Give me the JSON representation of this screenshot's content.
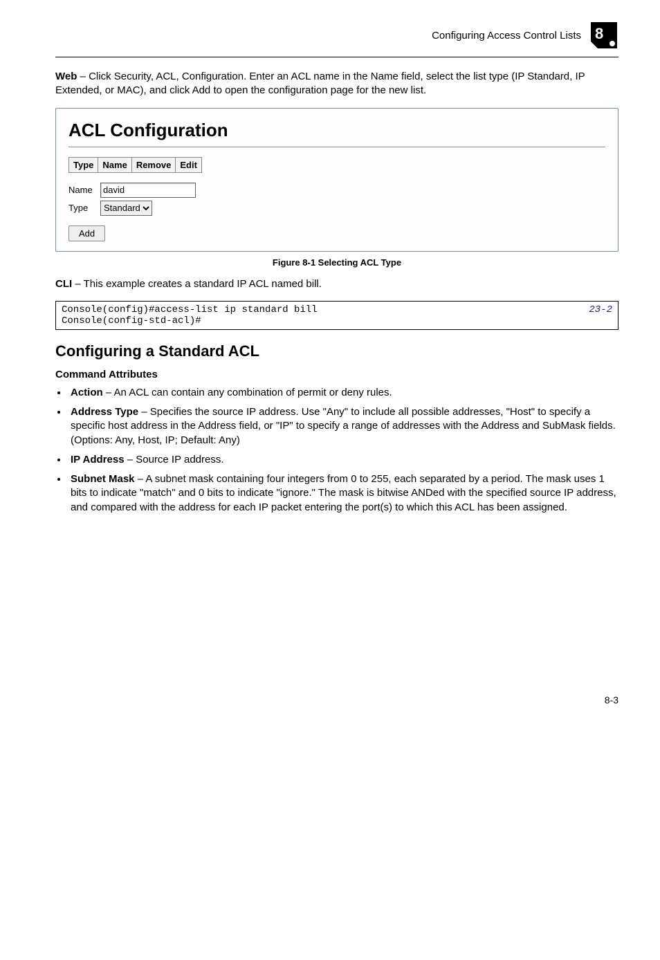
{
  "header": {
    "title": "Configuring Access Control Lists",
    "chapter": "8"
  },
  "intro": {
    "term": "Web",
    "text": " – Click Security, ACL, Configuration. Enter an ACL name in the Name field, select the list type (IP Standard, IP Extended, or MAC), and click Add to open the configuration page for the new list."
  },
  "screenshot": {
    "heading": "ACL Configuration",
    "table_headers": [
      "Type",
      "Name",
      "Remove",
      "Edit"
    ],
    "name_label": "Name",
    "name_value": "david",
    "type_label": "Type",
    "type_value": "Standard",
    "add_button": "Add"
  },
  "figure_caption": "Figure 8-1   Selecting ACL Type",
  "cli_intro": {
    "term": "CLI",
    "text": " – This example creates a standard IP ACL named bill."
  },
  "cli": {
    "lines": "Console(config)#access-list ip standard bill\nConsole(config-std-acl)#",
    "ref": "23-2"
  },
  "section_heading": "Configuring a Standard ACL",
  "subsection_heading": "Command Attributes",
  "bullets": [
    {
      "term": "Action",
      "text": " – An ACL can contain any combination of permit or deny rules."
    },
    {
      "term": "Address Type",
      "text": " – Specifies the source IP address. Use \"Any\" to include all possible addresses, \"Host\" to specify a specific host address in the Address field, or \"IP\" to specify a range of addresses with the Address and SubMask fields. (Options: Any, Host, IP; Default: Any)"
    },
    {
      "term": "IP Address",
      "text": " – Source IP address."
    },
    {
      "term": "Subnet Mask",
      "text": " – A subnet mask containing four integers from 0 to 255, each separated by a period. The mask uses 1 bits to indicate \"match\" and 0 bits to indicate \"ignore.\" The mask is bitwise ANDed with the specified source IP address, and compared with the address for each IP packet entering the port(s) to which this ACL has been assigned."
    }
  ],
  "page_number": "8-3"
}
